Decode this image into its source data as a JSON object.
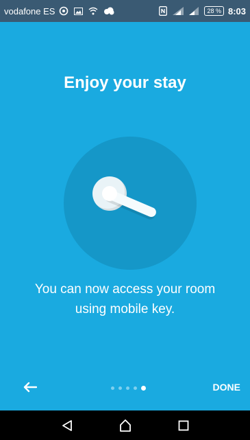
{
  "status_bar": {
    "carrier": "vodafone ES",
    "battery": "28 %",
    "time": "8:03",
    "icons": [
      "whatsapp-icon",
      "image-icon",
      "wifi-icon",
      "cloud-icon",
      "nfc-icon",
      "wifi-signal-icon",
      "cell-signal-icon"
    ]
  },
  "main": {
    "title": "Enjoy your stay",
    "message": "You can now access your room using mobile key.",
    "illustration": "door-handle-icon",
    "background_color": "#1aaae0"
  },
  "footer": {
    "back_icon": "arrow-left-icon",
    "done_label": "DONE",
    "page_indicator": {
      "total": 5,
      "current": 5
    }
  },
  "nav_bar": {
    "buttons": [
      "back-triangle-icon",
      "home-icon",
      "recents-icon"
    ]
  }
}
